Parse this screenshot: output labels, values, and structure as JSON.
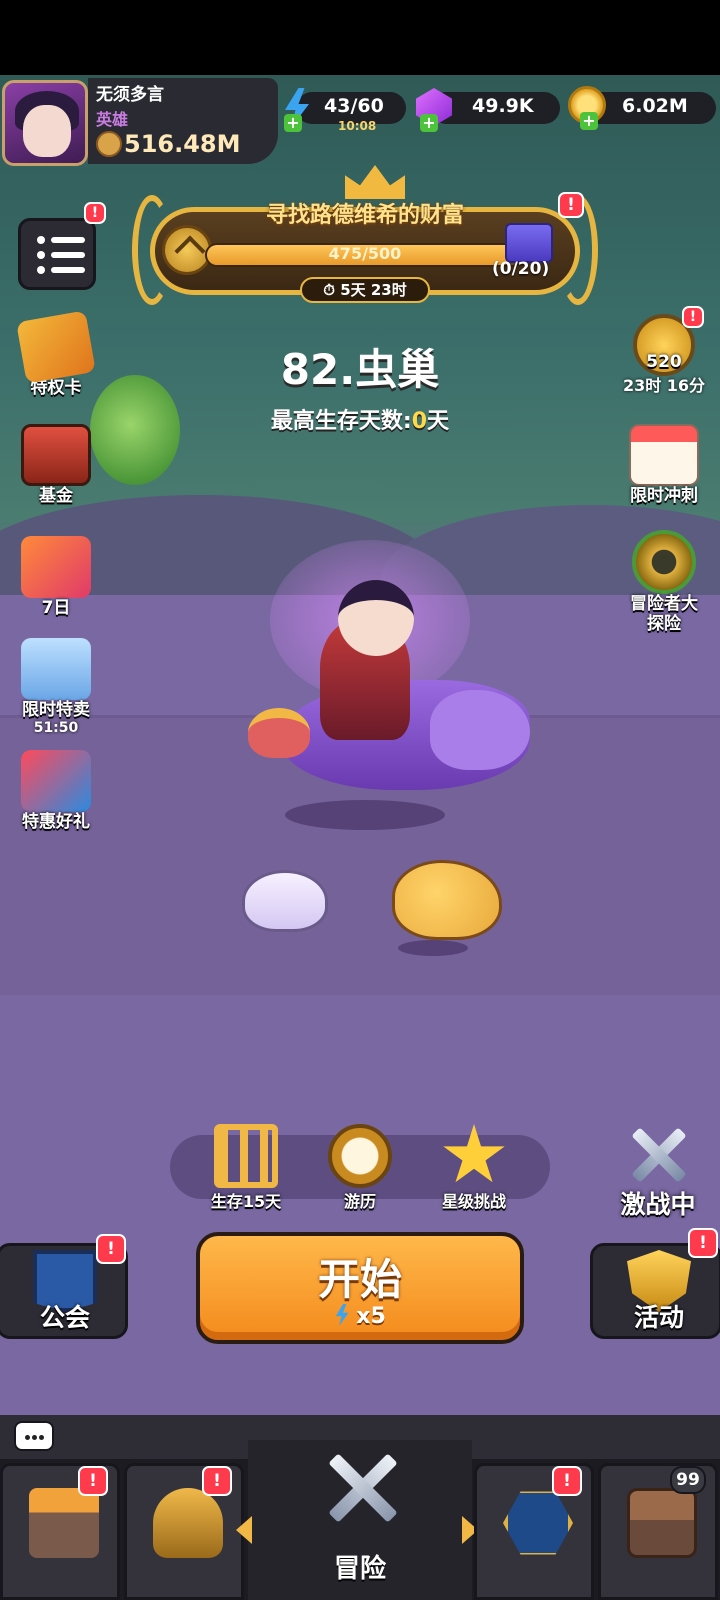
{
  "player": {
    "name": "无须多言",
    "rank": "英雄",
    "power": "516.48M"
  },
  "resources": {
    "energy": "43/60",
    "energy_timer": "10:08",
    "gems": "49.9K",
    "gold": "6.02M"
  },
  "event": {
    "title": "寻找路德维希的财富",
    "progress_text": "475/500",
    "progress_fraction": 0.95,
    "reward_count": "(0/20)",
    "time_left": "5天 23时"
  },
  "stage": {
    "title": "82.虫巢",
    "best_label": "最高生存天数:",
    "best_value": "0",
    "best_unit": "天"
  },
  "left_icons": [
    {
      "label": "特权卡",
      "sub": ""
    },
    {
      "label": "基金",
      "sub": ""
    },
    {
      "label": "7日",
      "sub": ""
    },
    {
      "label": "限时特卖",
      "sub": "51:50"
    },
    {
      "label": "特惠好礼",
      "sub": ""
    }
  ],
  "right_icons": [
    {
      "label": "520",
      "sub": "23时 16分"
    },
    {
      "label": "限时冲刺",
      "sub": ""
    },
    {
      "label": "冒险者大探险",
      "sub": ""
    }
  ],
  "modes": [
    {
      "label": "生存15天",
      "icon": "gate-icon"
    },
    {
      "label": "游历",
      "icon": "compass-clock-icon"
    },
    {
      "label": "星级挑战",
      "icon": "star-icon"
    }
  ],
  "battle_label": "激战中",
  "guild_label": "公会",
  "activity_label": "活动",
  "start": {
    "label": "开始",
    "cost": "x5"
  },
  "nav": {
    "center_label": "冒险",
    "chest_count": "99"
  },
  "badge_mark": "!",
  "colors": {
    "accent_gold": "#f1b845",
    "start_orange": "#f48a1c",
    "alert_red": "#ff3a4c",
    "ground_purple": "#7a68a3"
  }
}
